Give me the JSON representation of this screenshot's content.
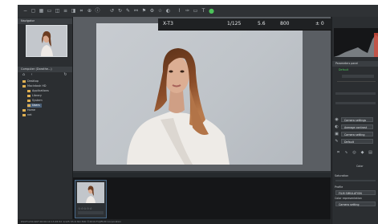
{
  "navigator": {
    "title": "Navigator"
  },
  "browser": {
    "title": "Computer (Dorothe...)",
    "folders": [
      {
        "label": "Desktop"
      },
      {
        "label": "Macintosh HD"
      },
      {
        "label": "Applications"
      },
      {
        "label": "Library"
      },
      {
        "label": "System"
      },
      {
        "label": "Users"
      },
      {
        "label": "Home"
      },
      {
        "label": "net"
      }
    ]
  },
  "camera_overlay": {
    "model": "X-T3",
    "shutter": "1/125",
    "aperture": "5.6",
    "iso": "800",
    "ev": "± 0"
  },
  "right_panel": {
    "header": "Parameters panel",
    "default_label": "Default",
    "camera_settings": "Camera settings",
    "average_contrast": "Average contrast",
    "camera_setting": "Camera setting",
    "default2": "Default",
    "color_label": "Color",
    "saturation_label": "Saturation",
    "profile_label": "Profile",
    "film_sim": "FILM SIMULATION",
    "color_repr_label": "Color representation",
    "color_repr_value": "Camera setting"
  },
  "status": {
    "text": "DSCF1234.RAF  06:09:19 13:45:52  1/125  f/5.6  ISO 800  ©2019 FUJIFILM Corporation"
  },
  "colors": {
    "accent": "#4cc25a",
    "selection": "#4a5f77",
    "folder": "#e0b052"
  }
}
